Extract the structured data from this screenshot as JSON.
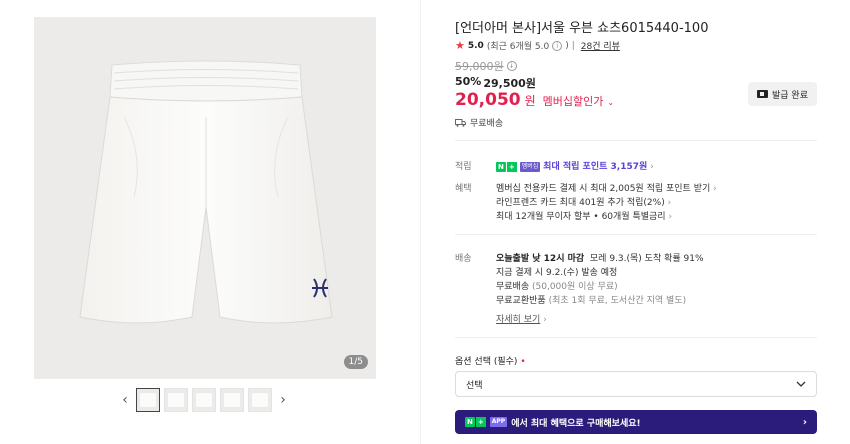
{
  "product": {
    "title": "[언더아머 본사]서울 우븐 쇼츠6015440-100",
    "rating": "5.0",
    "rating_note": "(최근 6개월 5.0",
    "rating_note_close": ")",
    "review_link": "28건 리뷰",
    "original_price": "59,000원",
    "discount_rate": "50%",
    "sale_price": "29,500원",
    "member_price": "20,050",
    "member_price_unit": "원",
    "member_label": "멤버십할인가",
    "free_shipping": "무료배송",
    "coupon_button": "발급 완료",
    "image_counter": "1/5"
  },
  "benefits": {
    "points_label": "적립",
    "points_badge_n": "N",
    "points_badge_plus": "+",
    "points_badge_tag": "멤버십",
    "points_text": "최대 적립 포인트 3,157원",
    "card_label": "혜택",
    "card_lines": [
      "멤버십 전용카드 결제 시 최대 2,005원 적립 포인트 받기",
      "라인프렌즈 카드 최대 401원 추가 적립(2%)",
      "최대 12개월 무이자 할부 • 60개월 특별금리"
    ]
  },
  "delivery": {
    "label": "배송",
    "today_bold": "오늘출발 낮 12시 마감",
    "today_rest": "모레 9.3.(목) 도착 확률 91%",
    "line2": "지금 결제 시 9.2.(수) 발송 예정",
    "line3_main": "무료배송",
    "line3_note": "(50,000원 이상 무료)",
    "line4_main": "무료교환반품",
    "line4_note": "(최초 1회 무료, 도서산간 지역 별도)",
    "detail_link": "자세히 보기"
  },
  "options": {
    "label": "옵션 선택 (필수)",
    "required_mark": "•",
    "select_value": "선택"
  },
  "banner": {
    "n": "N",
    "plus": "+",
    "app": "APP",
    "text": "에서 최대 혜택으로 구매해보세요!"
  },
  "icons": {
    "prev": "chevron-left-icon",
    "next": "chevron-right-icon"
  },
  "colors": {
    "accent": "#e0204e",
    "naver_green": "#03c75a",
    "banner_bg": "#2b1b7a",
    "point_purple": "#5b3fd9"
  }
}
